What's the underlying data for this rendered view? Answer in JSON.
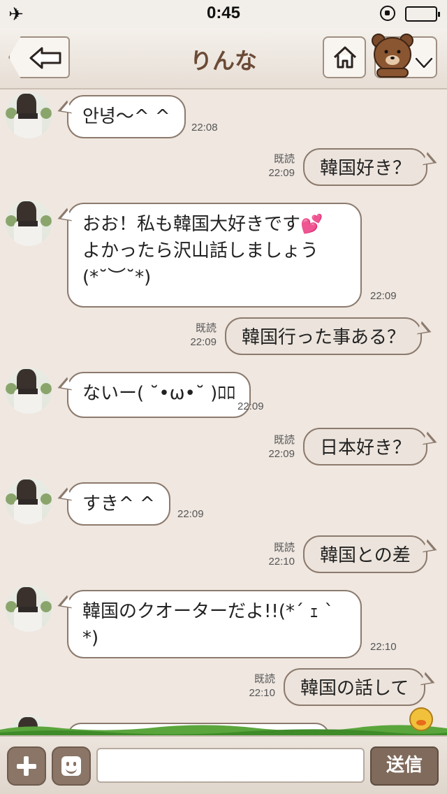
{
  "status_bar": {
    "time": "0:45"
  },
  "nav": {
    "title": "りんな"
  },
  "messages": {
    "m1": {
      "text": "안녕〜^ ^",
      "time": "22:08"
    },
    "m2": {
      "read": "既読",
      "time": "22:09",
      "text": "韓国好き？"
    },
    "m3": {
      "line1": "おお！私も韓国大好きです💕",
      "line2": "よかったら沢山話しましょう",
      "line3": "(*˘︶˘*)",
      "time": "22:09"
    },
    "m4": {
      "read": "既読",
      "time": "22:09",
      "text": "韓国行った事ある？"
    },
    "m5": {
      "text": "ないー( ˘•ω•˘ )ﾛﾛ",
      "time": "22:09"
    },
    "m6": {
      "read": "既読",
      "time": "22:09",
      "text": "日本好き？"
    },
    "m7": {
      "text": "すき^ ^",
      "time": "22:09"
    },
    "m8": {
      "read": "既読",
      "time": "22:10",
      "text": "韓国との差"
    },
    "m9": {
      "line1": "韓国のクオーターだよ!!(*´ ｪ `",
      "line2": "*)",
      "time": "22:10"
    },
    "m10": {
      "read": "既読",
      "time": "22:10",
      "text": "韓国の話して"
    }
  },
  "input": {
    "placeholder": "",
    "send_label": "送信"
  }
}
